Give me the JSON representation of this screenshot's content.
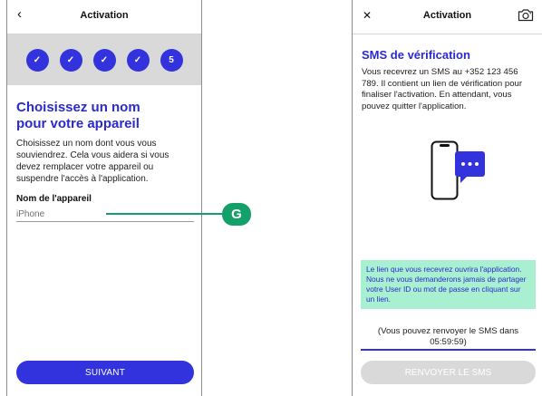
{
  "left_screen": {
    "header": {
      "back_icon": "‹",
      "title": "Activation"
    },
    "stepper": {
      "steps": [
        "✓",
        "✓",
        "✓",
        "✓",
        "5"
      ],
      "current_step": 5,
      "total_steps": 5
    },
    "heading": "Choisissez un nom pour votre appareil",
    "description": "Choisissez un nom dont vous vous souviendrez. Cela vous aidera si vous devez remplacer votre appareil ou suspendre l'accès à l'application.",
    "field_label": "Nom de l'appareil",
    "field_value": "iPhone",
    "button_label": "SUIVANT"
  },
  "callout": {
    "label": "G",
    "color": "#15a06b"
  },
  "right_screen": {
    "header": {
      "close_icon": "✕",
      "title": "Activation",
      "camera_icon": "camera-icon"
    },
    "heading": "SMS de vérification",
    "description": "Vous recevrez un SMS au +352 123 456 789. Il contient un lien de vérification pour finaliser l'activation. En attendant, vous pouvez quitter l'application.",
    "notice": "Le lien que vous recevrez ouvrira l'application. Nous ne vous demanderons jamais de partager votre User ID ou mot de passe en cliquant sur un lien.",
    "resend_info": "(Vous pouvez renvoyer le SMS dans",
    "countdown": "05:59:59)",
    "button_label": "RENVOYER LE SMS"
  },
  "colors": {
    "primary": "#3333dd",
    "accent_green": "#15a06b",
    "notice_bg": "#a9f0d0",
    "disabled": "#d9d9d9"
  }
}
